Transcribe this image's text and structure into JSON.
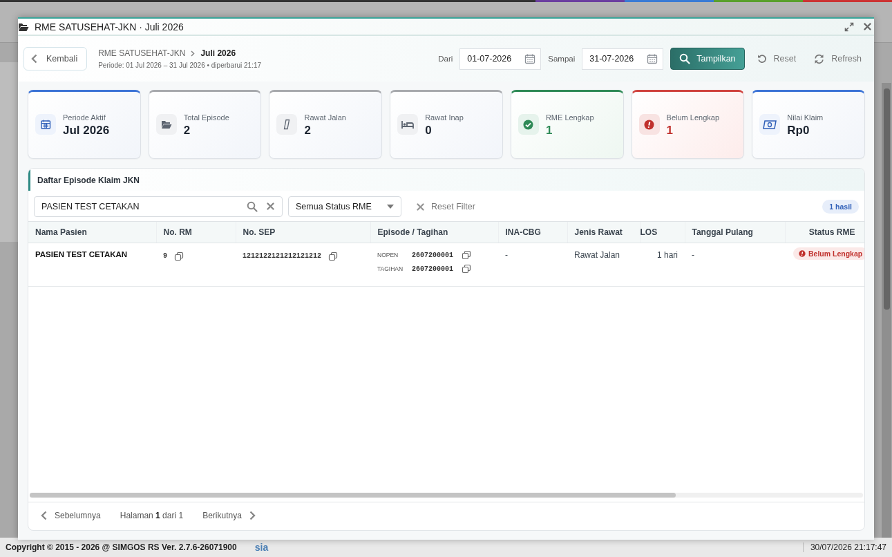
{
  "modal": {
    "title": "RME SATUSEHAT-JKN · Juli 2026",
    "back_button": "Kembali",
    "breadcrumb": [
      "RME SATUSEHAT-JKN",
      "Juli 2026"
    ],
    "period": "Periode: 01 Jul 2026 – 31 Jul 2026 • diperbarui 21:17",
    "from_label": "Dari",
    "from_value": "01-07-2026",
    "to_label": "Sampai",
    "to_value": "31-07-2026",
    "actions": [
      {
        "kind": "primary",
        "label": "Tampilkan"
      },
      {
        "kind": "reset",
        "label": "Reset"
      },
      {
        "kind": "refresh",
        "label": "Refresh"
      }
    ]
  },
  "stats": [
    {
      "kind": "period",
      "label": "Periode Aktif",
      "value": "Jul 2026"
    },
    {
      "kind": "episodes",
      "label": "Total Episode",
      "value": "2"
    },
    {
      "kind": "outpatient",
      "label": "Rawat Jalan",
      "value": "2"
    },
    {
      "kind": "inpatient",
      "label": "Rawat Inap",
      "value": "0"
    },
    {
      "kind": "complete",
      "label": "RME Lengkap",
      "value": "1"
    },
    {
      "kind": "incomplete",
      "label": "Belum Lengkap",
      "value": "1"
    },
    {
      "kind": "claim",
      "label": "Nilai Klaim",
      "value": "Rp0"
    }
  ],
  "episodes": {
    "title": "Daftar Episode Klaim JKN",
    "search": {
      "value": "PASIEN TEST CETAKAN"
    },
    "status_filter": "Semua Status RME",
    "reset_filter": "Reset Filter",
    "result_count": "1 hasil",
    "columns": [
      "Nama Pasien",
      "No. RM",
      "No. SEP",
      "Episode / Tagihan",
      "INA-CBG",
      "Jenis Rawat",
      "LOS",
      "Tanggal Pulang",
      "Status RME"
    ],
    "rows": [
      {
        "name": "PASIEN TEST CETAKAN",
        "rm": "9",
        "sep": "1212122121212121212",
        "episode": [
          {
            "label": "NOPEN",
            "value": "2607200001"
          },
          {
            "label": "TAGIHAN",
            "value": "2607200001"
          }
        ],
        "ina_cbg": "-",
        "care_type": "Rawat Jalan",
        "los": "1 hari",
        "discharge_date": "-",
        "status": {
          "label": "Belum Lengkap",
          "complete": false
        }
      }
    ],
    "pagination": {
      "previous": "Sebelumnya",
      "page": "Halaman **1** dari 1",
      "next": "Berikutnya"
    }
  },
  "footer": {
    "copyright": "Copyright © 2015 - 2026 @ SIMGOS RS Ver. 2.7.6-26071900",
    "org": "sia",
    "datetime": "30/07/2026 21:17:47"
  }
}
